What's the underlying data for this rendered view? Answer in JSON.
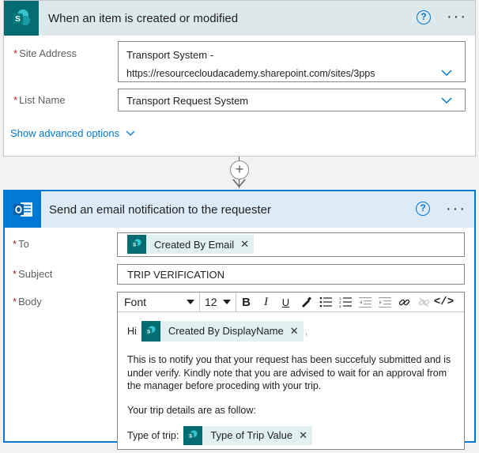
{
  "trigger": {
    "title": "When an item is created or modified",
    "site_label": "Site Address",
    "site_line1": "Transport System -",
    "site_line2": "https://resourcecloudacademy.sharepoint.com/sites/3pps",
    "list_label": "List Name",
    "list_value": "Transport Request System",
    "advanced_label": "Show advanced options"
  },
  "action": {
    "title": "Send an email notification to the requester",
    "to_label": "To",
    "to_token": "Created By Email",
    "subject_label": "Subject",
    "subject_value": "TRIP VERIFICATION",
    "body_label": "Body",
    "toolbar": {
      "font": "Font",
      "size": "12"
    },
    "body": {
      "greeting": "Hi",
      "greeting_token": "Created By DisplayName",
      "trailing": ",",
      "paragraph": "This is to notify you that your request has been succefuly submitted and is under verify. Kindly note that you are advised to wait for an approval from the manager before proceding with your trip.",
      "details_intro": "Your trip details are as follow:",
      "trip_label": "Type of trip:",
      "trip_token": "Type of Trip Value"
    }
  },
  "colors": {
    "sharepoint": "#036c70",
    "outlook": "#0078d4",
    "required": "#a4262c"
  }
}
